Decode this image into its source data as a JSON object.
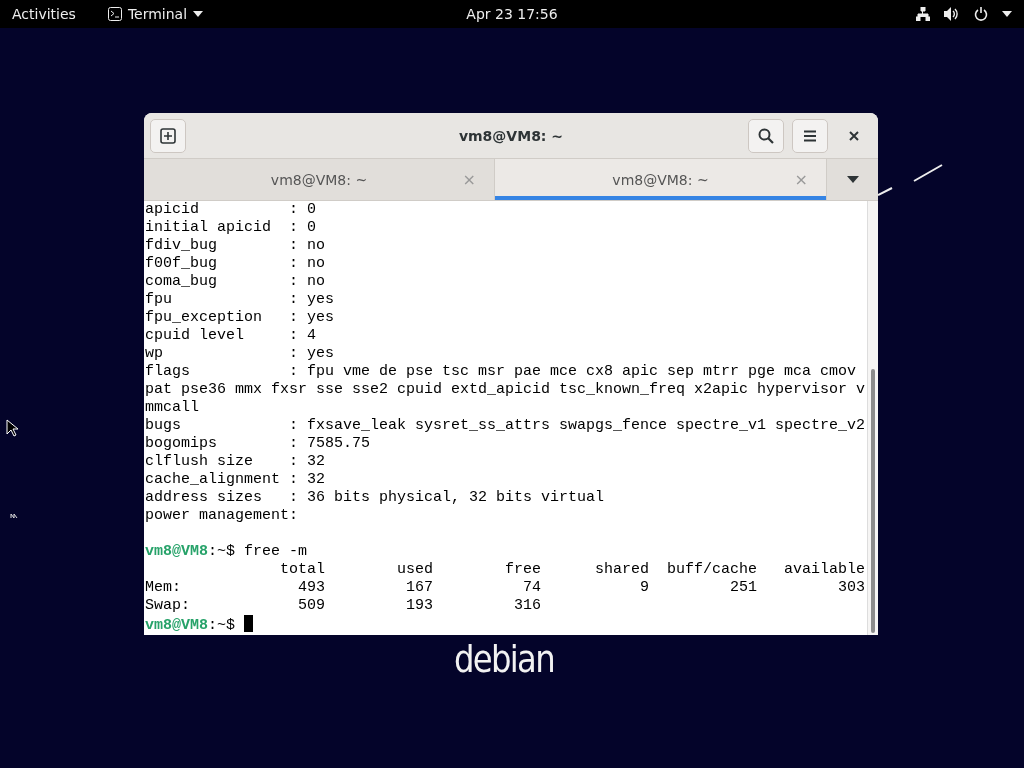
{
  "top_bar": {
    "activities": "Activities",
    "app_menu": "Terminal",
    "clock": "Apr 23  17:56"
  },
  "window": {
    "title": "vm8@VM8: ~",
    "tabs": [
      {
        "label": "vm8@VM8: ~",
        "close": "×",
        "selected": false
      },
      {
        "label": "vm8@VM8: ~",
        "close": "×",
        "selected": true
      }
    ],
    "lines": [
      {
        "kind": "output",
        "text": "apicid          : 0"
      },
      {
        "kind": "output",
        "text": "initial apicid  : 0"
      },
      {
        "kind": "output",
        "text": "fdiv_bug        : no"
      },
      {
        "kind": "output",
        "text": "f00f_bug        : no"
      },
      {
        "kind": "output",
        "text": "coma_bug        : no"
      },
      {
        "kind": "output",
        "text": "fpu             : yes"
      },
      {
        "kind": "output",
        "text": "fpu_exception   : yes"
      },
      {
        "kind": "output",
        "text": "cpuid level     : 4"
      },
      {
        "kind": "output",
        "text": "wp              : yes"
      },
      {
        "kind": "output",
        "text": "flags           : fpu vme de pse tsc msr pae mce cx8 apic sep mtrr pge mca cmov"
      },
      {
        "kind": "output",
        "text": "pat pse36 mmx fxsr sse sse2 cpuid extd_apicid tsc_known_freq x2apic hypervisor v"
      },
      {
        "kind": "output",
        "text": "mmcall"
      },
      {
        "kind": "output",
        "text": "bugs            : fxsave_leak sysret_ss_attrs swapgs_fence spectre_v1 spectre_v2"
      },
      {
        "kind": "output",
        "text": "bogomips        : 7585.75"
      },
      {
        "kind": "output",
        "text": "clflush size    : 32"
      },
      {
        "kind": "output",
        "text": "cache_alignment : 32"
      },
      {
        "kind": "output",
        "text": "address sizes   : 36 bits physical, 32 bits virtual"
      },
      {
        "kind": "output",
        "text": "power management:"
      },
      {
        "kind": "blank"
      },
      {
        "kind": "prompt",
        "user": "vm8@VM8",
        "text": ":~$ free -m"
      },
      {
        "kind": "output",
        "text": "               total        used        free      shared  buff/cache   available"
      },
      {
        "kind": "output",
        "text": "Mem:             493         167          74           9         251         303"
      },
      {
        "kind": "output",
        "text": "Swap:            509         193         316"
      },
      {
        "kind": "prompt",
        "user": "vm8@VM8",
        "text": ":~$ ",
        "cursor": true
      }
    ]
  },
  "wallpaper_logo": "debian"
}
